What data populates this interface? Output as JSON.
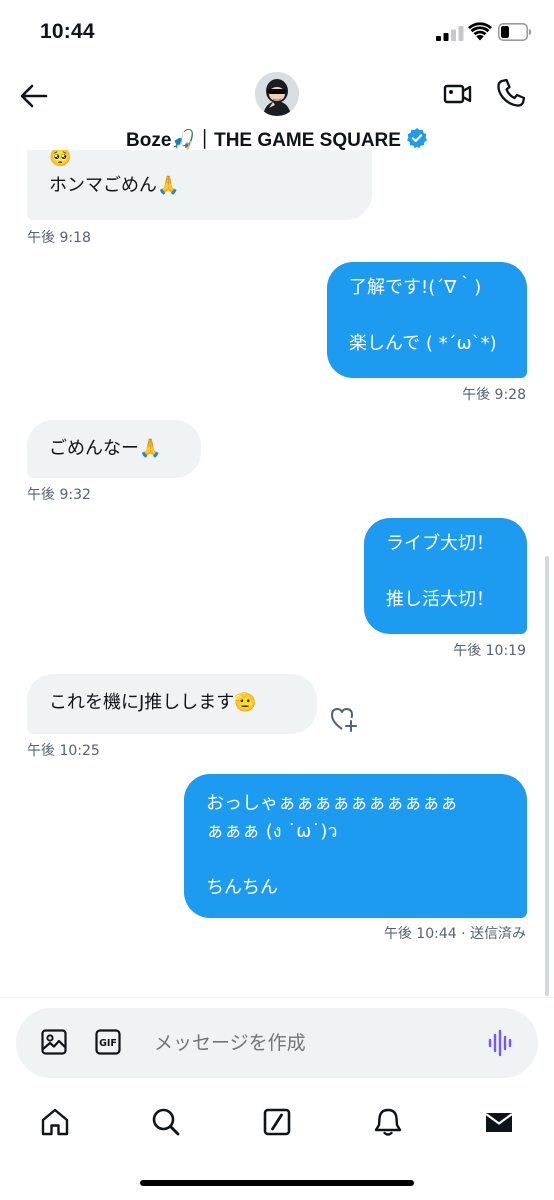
{
  "status_bar": {
    "time": "10:44"
  },
  "header": {
    "title": "Boze🎣｜THE GAME SQUARE",
    "avatar_icon": "avatar-image"
  },
  "messages": [
    {
      "type": "received",
      "text": "🥺\nホンマごめん🙏",
      "time": "午後 9:18"
    },
    {
      "type": "sent",
      "text": "了解です!(´∇｀)\n\n楽しんで ( *´ω`*)",
      "time": "午後 9:28"
    },
    {
      "type": "received",
      "text": "ごめんなー🙏",
      "time": "午後 9:32"
    },
    {
      "type": "sent",
      "text": "ライブ大切！\n\n推し活大切！",
      "time": "午後 10:19"
    },
    {
      "type": "received",
      "text": "これを機にJ推しします🫡",
      "time": "午後 10:25"
    },
    {
      "type": "sent",
      "text": "おっしゃぁぁぁぁぁぁぁぁぁぁ\nぁぁぁ (ง ˙ω˙)ว\n\nちんちん",
      "time": "午後 10:44 · 送信済み"
    }
  ],
  "composer": {
    "placeholder": "メッセージを作成",
    "gif_label": "GIF"
  },
  "colors": {
    "accent": "#1d9bf0",
    "received_bubble": "#eff3f4",
    "timestamp": "#536471",
    "voice_icon": "#7856ff"
  }
}
